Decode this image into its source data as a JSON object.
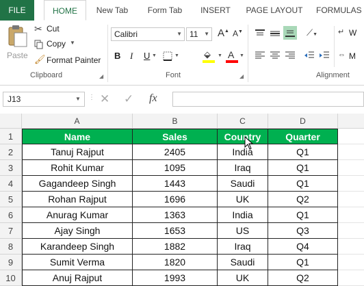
{
  "ribbon_tabs": {
    "file": "FILE",
    "home": "HOME",
    "new_tab": "New Tab",
    "form_tab": "Form Tab",
    "insert": "INSERT",
    "page_layout": "PAGE LAYOUT",
    "formulas": "FORMULAS"
  },
  "clipboard": {
    "paste": "Paste",
    "cut": "Cut",
    "copy": "Copy",
    "format_painter": "Format Painter",
    "group_label": "Clipboard"
  },
  "font": {
    "name": "Calibri",
    "size": "11",
    "bold": "B",
    "italic": "I",
    "underline": "U",
    "grow": "A",
    "shrink": "A",
    "font_color": "A",
    "group_label": "Font"
  },
  "alignment": {
    "wrap": "W",
    "merge": "M",
    "group_label": "Alignment"
  },
  "formula_bar": {
    "name_box": "J13",
    "fx": "fx"
  },
  "columns": [
    "A",
    "B",
    "C",
    "D"
  ],
  "rows": [
    "1",
    "2",
    "3",
    "4",
    "5",
    "6",
    "7",
    "8",
    "9",
    "10"
  ],
  "table": {
    "headers": [
      "Name",
      "Sales",
      "Country",
      "Quarter"
    ],
    "data": [
      [
        "Tanuj Rajput",
        "2405",
        "India",
        "Q1"
      ],
      [
        "Rohit Kumar",
        "1095",
        "Iraq",
        "Q1"
      ],
      [
        "Gagandeep Singh",
        "1443",
        "Saudi",
        "Q1"
      ],
      [
        "Rohan Rajput",
        "1696",
        "UK",
        "Q2"
      ],
      [
        "Anurag Kumar",
        "1363",
        "India",
        "Q1"
      ],
      [
        "Ajay Singh",
        "1653",
        "US",
        "Q3"
      ],
      [
        "Karandeep Singh",
        "1882",
        "Iraq",
        "Q4"
      ],
      [
        "Sumit Verma",
        "1820",
        "Saudi",
        "Q1"
      ],
      [
        "Anuj Rajput",
        "1993",
        "UK",
        "Q2"
      ]
    ]
  },
  "colors": {
    "header_fill": "#00b050",
    "excel_green": "#217346"
  }
}
